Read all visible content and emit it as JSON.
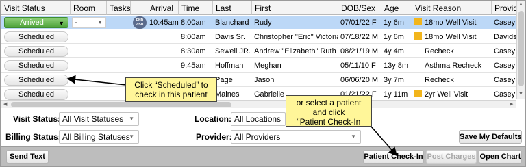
{
  "columns": [
    "Visit Status",
    "Room",
    "Tasks",
    "",
    "Arrival",
    "Time",
    "Last",
    "First",
    "DOB/Sex",
    "Age",
    "Visit Reason",
    "Provider"
  ],
  "rows": [
    {
      "status": "Arrived",
      "room": "-",
      "end_visit": "END VISIT",
      "arrival": "10:45am",
      "time": "8:00am",
      "last": "Blanchard",
      "first": "Rudy",
      "dob": "07/01/22 F",
      "age": "1y 6m",
      "reason": "18mo Well Visit",
      "flag": true,
      "provider": "Casey"
    },
    {
      "status": "Scheduled",
      "time": "8:00am",
      "last": "Davis Sr.",
      "first": "Christopher \"Eric\" Victoria",
      "dob": "07/18/22 M",
      "age": "1y 6m",
      "reason": "18mo Well Visit",
      "flag": true,
      "provider": "Davids"
    },
    {
      "status": "Scheduled",
      "time": "8:30am",
      "last": "Sewell JR.",
      "first": "Andrew \"Elizabeth\" Ruth",
      "dob": "08/21/19 M",
      "age": "4y 4m",
      "reason": "Recheck",
      "flag": false,
      "provider": "Casey"
    },
    {
      "status": "Scheduled",
      "time": "9:45am",
      "last": "Hoffman",
      "first": "Meghan",
      "dob": "05/11/10 F",
      "age": "13y 8m",
      "reason": "Asthma Recheck",
      "flag": false,
      "provider": "Casey"
    },
    {
      "status": "Scheduled",
      "time": "",
      "last": "Page",
      "first": "Jason",
      "dob": "06/06/20 M",
      "age": "3y 7m",
      "reason": "Recheck",
      "flag": false,
      "provider": "Casey"
    },
    {
      "status": "Scheduled",
      "time": "",
      "last": "Maines",
      "first": "Gabrielle",
      "dob": "01/21/22 F",
      "age": "1y 11m",
      "reason": "2yr Well Visit",
      "flag": true,
      "provider": "Casey"
    }
  ],
  "filters": {
    "visit_status_label": "Visit Status:",
    "visit_status_value": "All Visit Statuses",
    "billing_status_label": "Billing Status:",
    "billing_status_value": "All Billing Statuses",
    "location_label": "Location:",
    "location_value": "All Locations",
    "provider_label": "Provider:",
    "provider_value": "All Providers"
  },
  "buttons": {
    "save_defaults": "Save My Defaults",
    "send_text": "Send Text",
    "patient_checkin": "Patient Check-In",
    "post_charges": "Post Charges",
    "open_chart": "Open Chart"
  },
  "callouts": {
    "scheduled": [
      "Click “Scheduled” to",
      "check in this patient"
    ],
    "checkin": [
      "or select a patient",
      "and click",
      "“Patient Check-In"
    ]
  },
  "colors": {
    "accent_callout": "#fff699",
    "arrived_green": "#4ea33b",
    "selected_row": "#bcd8f7",
    "flag": "#f2b51c"
  }
}
